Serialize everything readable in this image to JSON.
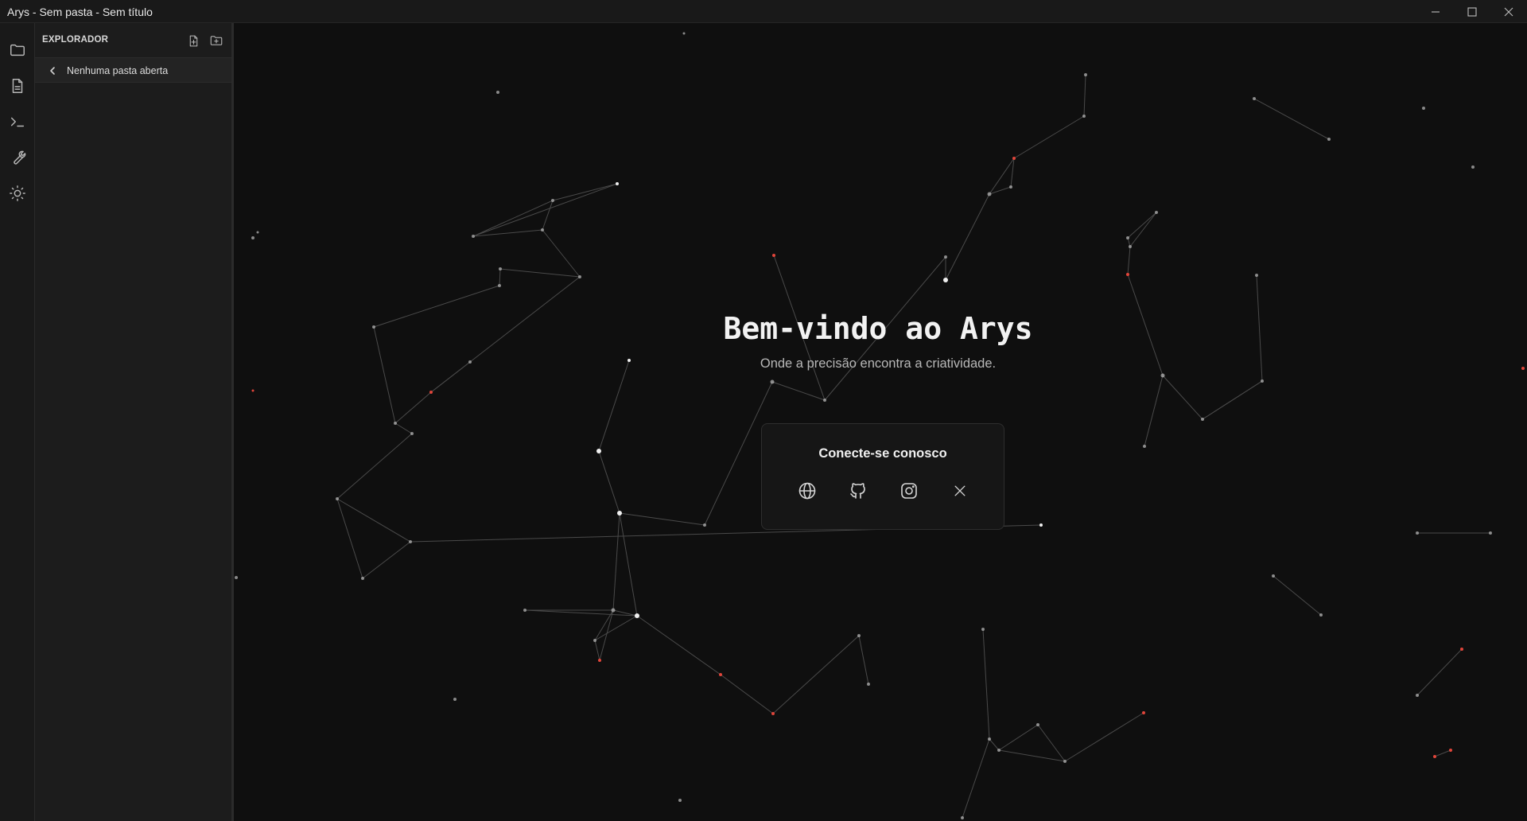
{
  "window": {
    "app_name": "Arys",
    "separator": " - ",
    "folder": "Sem pasta",
    "file": "Sem título",
    "controls": [
      "minimize-icon",
      "maximize-icon",
      "close-icon"
    ]
  },
  "activity_bar": {
    "items": [
      {
        "icon": "folder-icon"
      },
      {
        "icon": "file-icon"
      },
      {
        "icon": "terminal-icon"
      },
      {
        "icon": "wrench-icon"
      },
      {
        "icon": "sun-icon"
      }
    ]
  },
  "sidebar": {
    "title": "EXPLORADOR",
    "actions": [
      "new-file-icon",
      "new-folder-icon"
    ],
    "folder_status": "Nenhuma pasta aberta"
  },
  "welcome": {
    "title": "Bem-vindo ao Arys",
    "subtitle": "Onde a precisão encontra a criatividade.",
    "connect": {
      "title": "Conecte-se conosco",
      "links": [
        "globe-icon",
        "github-icon",
        "instagram-icon",
        "x-icon"
      ]
    }
  },
  "colors": {
    "background": "#0f0f0f",
    "panel": "#1c1c1c",
    "node": "#bdbdbd",
    "node_accent": "#e0453a",
    "edge": "#4a4a4a"
  }
}
